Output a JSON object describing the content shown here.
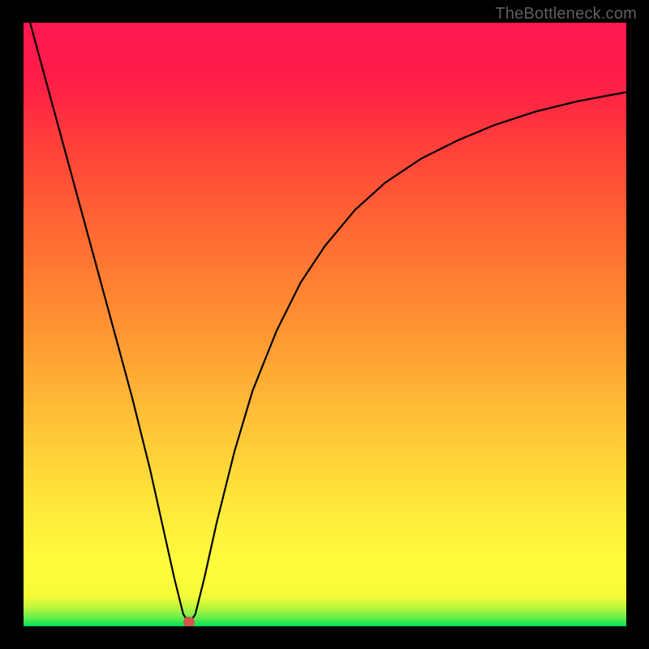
{
  "watermark": "TheBottleneck.com",
  "colors": {
    "frame": "#000000",
    "dot": "#d1574b",
    "curve": "#000000"
  },
  "dot": {
    "x_pct": 27.5,
    "y_pct": 99.3
  },
  "chart_data": {
    "type": "line",
    "title": "",
    "xlabel": "",
    "ylabel": "",
    "xlim": [
      0,
      100
    ],
    "ylim": [
      0,
      100
    ],
    "note": "Axes are unlabeled in source image; values below are percentage coordinates within the plot area (0 = left/bottom, 100 = right/top). Curve plunges from top-left to a minimum near x≈27 at y≈0, then rises asymptotically toward the upper right.",
    "series": [
      {
        "name": "curve",
        "x": [
          0,
          3,
          6,
          9,
          12,
          15,
          18,
          21,
          23,
          25,
          26.5,
          27.5,
          28.5,
          30,
          32,
          35,
          38,
          42,
          46,
          50,
          55,
          60,
          66,
          72,
          78,
          85,
          92,
          100
        ],
        "y": [
          104,
          93,
          82,
          71,
          60,
          49,
          38,
          26,
          17,
          8,
          2,
          0.5,
          2,
          8,
          17,
          29,
          39,
          49,
          57,
          63,
          69,
          73.5,
          77.5,
          80.5,
          83,
          85.3,
          87,
          88.5
        ]
      }
    ],
    "marker": {
      "x": 27.5,
      "y": 0.7
    }
  }
}
